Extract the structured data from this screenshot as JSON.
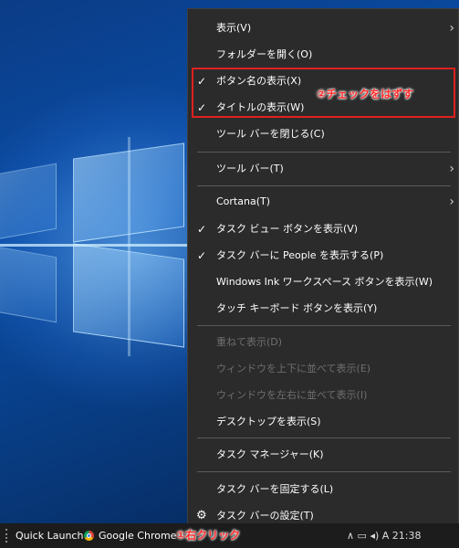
{
  "context_menu": {
    "items": [
      {
        "label": "表示(V)",
        "has_submenu": true,
        "checked": false,
        "enabled": true
      },
      {
        "label": "フォルダーを開く(O)",
        "has_submenu": false,
        "checked": false,
        "enabled": true
      },
      {
        "label": "ボタン名の表示(X)",
        "has_submenu": false,
        "checked": true,
        "enabled": true
      },
      {
        "label": "タイトルの表示(W)",
        "has_submenu": false,
        "checked": true,
        "enabled": true
      },
      {
        "label": "ツール バーを閉じる(C)",
        "has_submenu": false,
        "checked": false,
        "enabled": true
      },
      {
        "label": "ツール バー(T)",
        "has_submenu": true,
        "checked": false,
        "enabled": true
      },
      {
        "label": "Cortana(T)",
        "has_submenu": true,
        "checked": false,
        "enabled": true
      },
      {
        "label": "タスク ビュー ボタンを表示(V)",
        "has_submenu": false,
        "checked": true,
        "enabled": true
      },
      {
        "label": "タスク バーに People を表示する(P)",
        "has_submenu": false,
        "checked": true,
        "enabled": true
      },
      {
        "label": "Windows Ink ワークスペース ボタンを表示(W)",
        "has_submenu": false,
        "checked": false,
        "enabled": true
      },
      {
        "label": "タッチ キーボード ボタンを表示(Y)",
        "has_submenu": false,
        "checked": false,
        "enabled": true
      },
      {
        "label": "重ねて表示(D)",
        "has_submenu": false,
        "checked": false,
        "enabled": false
      },
      {
        "label": "ウィンドウを上下に並べて表示(E)",
        "has_submenu": false,
        "checked": false,
        "enabled": false
      },
      {
        "label": "ウィンドウを左右に並べて表示(I)",
        "has_submenu": false,
        "checked": false,
        "enabled": false
      },
      {
        "label": "デスクトップを表示(S)",
        "has_submenu": false,
        "checked": false,
        "enabled": true
      },
      {
        "label": "タスク マネージャー(K)",
        "has_submenu": false,
        "checked": false,
        "enabled": true
      },
      {
        "label": "タスク バーを固定する(L)",
        "has_submenu": false,
        "checked": false,
        "enabled": true
      },
      {
        "label": "タスク バーの設定(T)",
        "has_submenu": false,
        "checked": false,
        "enabled": true,
        "icon": "gear-icon"
      }
    ],
    "check_glyph": "✓",
    "submenu_glyph": "›",
    "gear_glyph": "⚙"
  },
  "annotations": {
    "step2": "②チェックをはずす",
    "step1": "①右クリック",
    "color": "#e02020"
  },
  "taskbar": {
    "quick_launch": "Quick Launch",
    "chrome": "Google Chrome",
    "tray": "∧ ▭ ◂) A 21:38"
  }
}
